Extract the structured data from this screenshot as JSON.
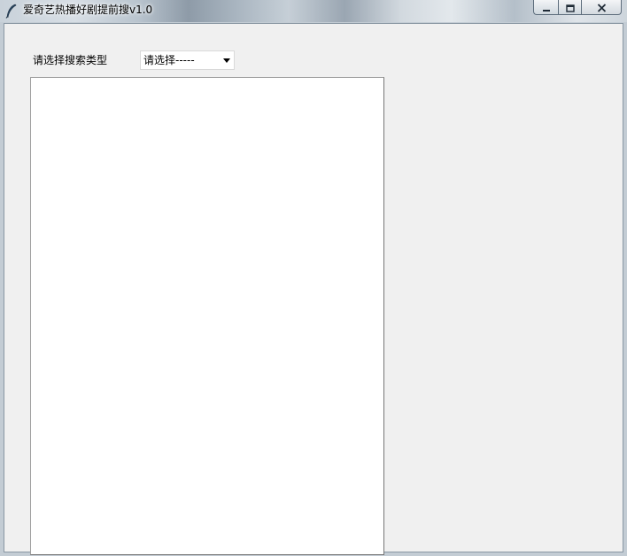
{
  "window": {
    "title": "爱奇艺热播好剧提前搜v1.0",
    "icon": "feather-icon",
    "controls": {
      "minimize_icon": "minimize-icon",
      "maximize_icon": "maximize-icon",
      "close_icon": "close-icon"
    }
  },
  "form": {
    "search_type_label": "请选择搜索类型",
    "search_type_select": {
      "selected": "请选择-----"
    },
    "output_text": ""
  },
  "colors": {
    "client_background": "#f0f0f0",
    "text_area_background": "#ffffff",
    "text": "#000000"
  }
}
